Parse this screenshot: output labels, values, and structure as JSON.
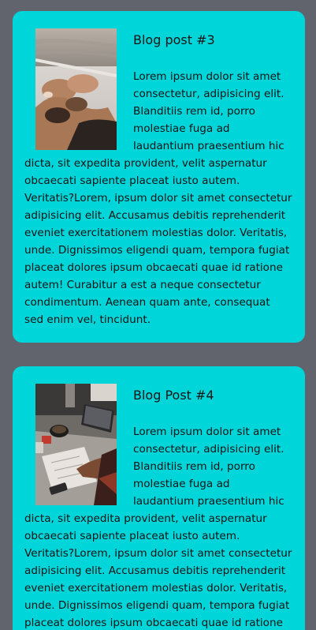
{
  "posts": [
    {
      "title": "Blog post #3",
      "image": "people-lying-on-boat-photo",
      "body": "Lorem ipsum dolor sit amet consectetur, adipisicing elit. Blanditiis rem id, porro molestiae fuga ad laudantium praesentium hic dicta, sit expedita provident, velit aspernatur obcaecati sapiente placeat iusto autem. Veritatis?Lorem, ipsum dolor sit amet consectetur adipisicing elit. Accusamus debitis reprehenderit eveniet exercitationem molestias dolor. Veritatis, unde. Dignissimos eligendi quam, tempora fugiat placeat dolores ipsum obcaecati quae id ratione autem! Curabitur a est a neque consectetur condimentum. Aenean quam ante, consequat sed enim vel, tincidunt."
    },
    {
      "title": "Blog Post #4",
      "image": "desk-workspace-photo",
      "body": "Lorem ipsum dolor sit amet consectetur, adipisicing elit. Blanditiis rem id, porro molestiae fuga ad laudantium praesentium hic dicta, sit expedita provident, velit aspernatur obcaecati sapiente placeat iusto autem. Veritatis?Lorem, ipsum dolor sit amet consectetur adipisicing elit. Accusamus debitis reprehenderit eveniet exercitationem molestias dolor. Veritatis, unde. Dignissimos eligendi quam, tempora fugiat placeat dolores ipsum obcaecati quae id ratione autem!"
    }
  ],
  "colors": {
    "page_background": "#62646d",
    "card_background": "#00d5da",
    "text": "#141414"
  }
}
